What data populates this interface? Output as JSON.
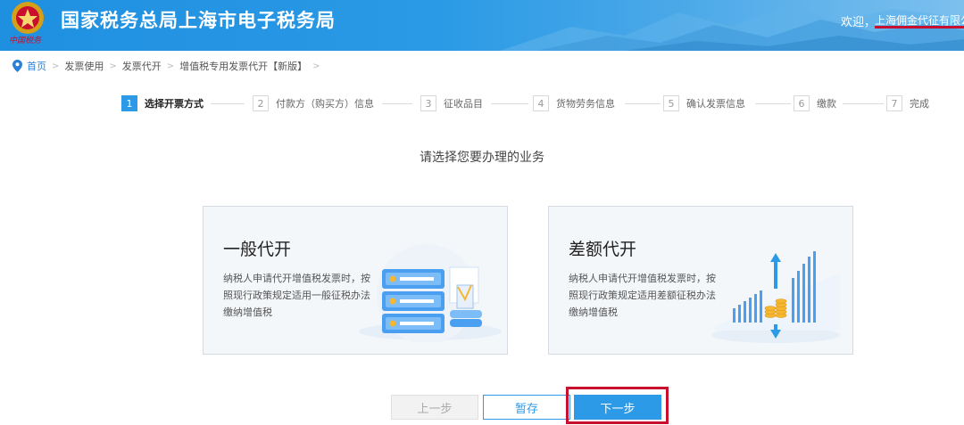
{
  "header": {
    "emblem_text": "中国税务",
    "title": "国家税务总局上海市电子税务局",
    "welcome_label": "欢迎，",
    "user_name": "上海佣金代征有限公司"
  },
  "breadcrumb": {
    "items": [
      "首页",
      "发票使用",
      "发票代开",
      "增值税专用发票代开【新版】"
    ]
  },
  "steps": [
    {
      "num": "1",
      "label": "选择开票方式",
      "active": true
    },
    {
      "num": "2",
      "label": "付款方（购买方）信息",
      "active": false
    },
    {
      "num": "3",
      "label": "征收品目",
      "active": false
    },
    {
      "num": "4",
      "label": "货物劳务信息",
      "active": false
    },
    {
      "num": "5",
      "label": "确认发票信息",
      "active": false
    },
    {
      "num": "6",
      "label": "缴款",
      "active": false
    },
    {
      "num": "7",
      "label": "完成",
      "active": false
    }
  ],
  "prompt": "请选择您要办理的业务",
  "cards": [
    {
      "title": "一般代开",
      "desc": "纳税人申请代开增值税发票时，按照现行政策规定适用一般征税办法缴纳增值税",
      "icon": "server-stack-icon"
    },
    {
      "title": "差额代开",
      "desc": "纳税人申请代开增值税发票时，按照现行政策规定适用差额征税办法缴纳增值税",
      "icon": "bar-growth-icon"
    }
  ],
  "buttons": {
    "prev": "上一步",
    "save": "暂存",
    "next": "下一步"
  },
  "colors": {
    "primary": "#2d9ae8",
    "header": "#1f8fe0",
    "highlight": "#c8102e"
  }
}
